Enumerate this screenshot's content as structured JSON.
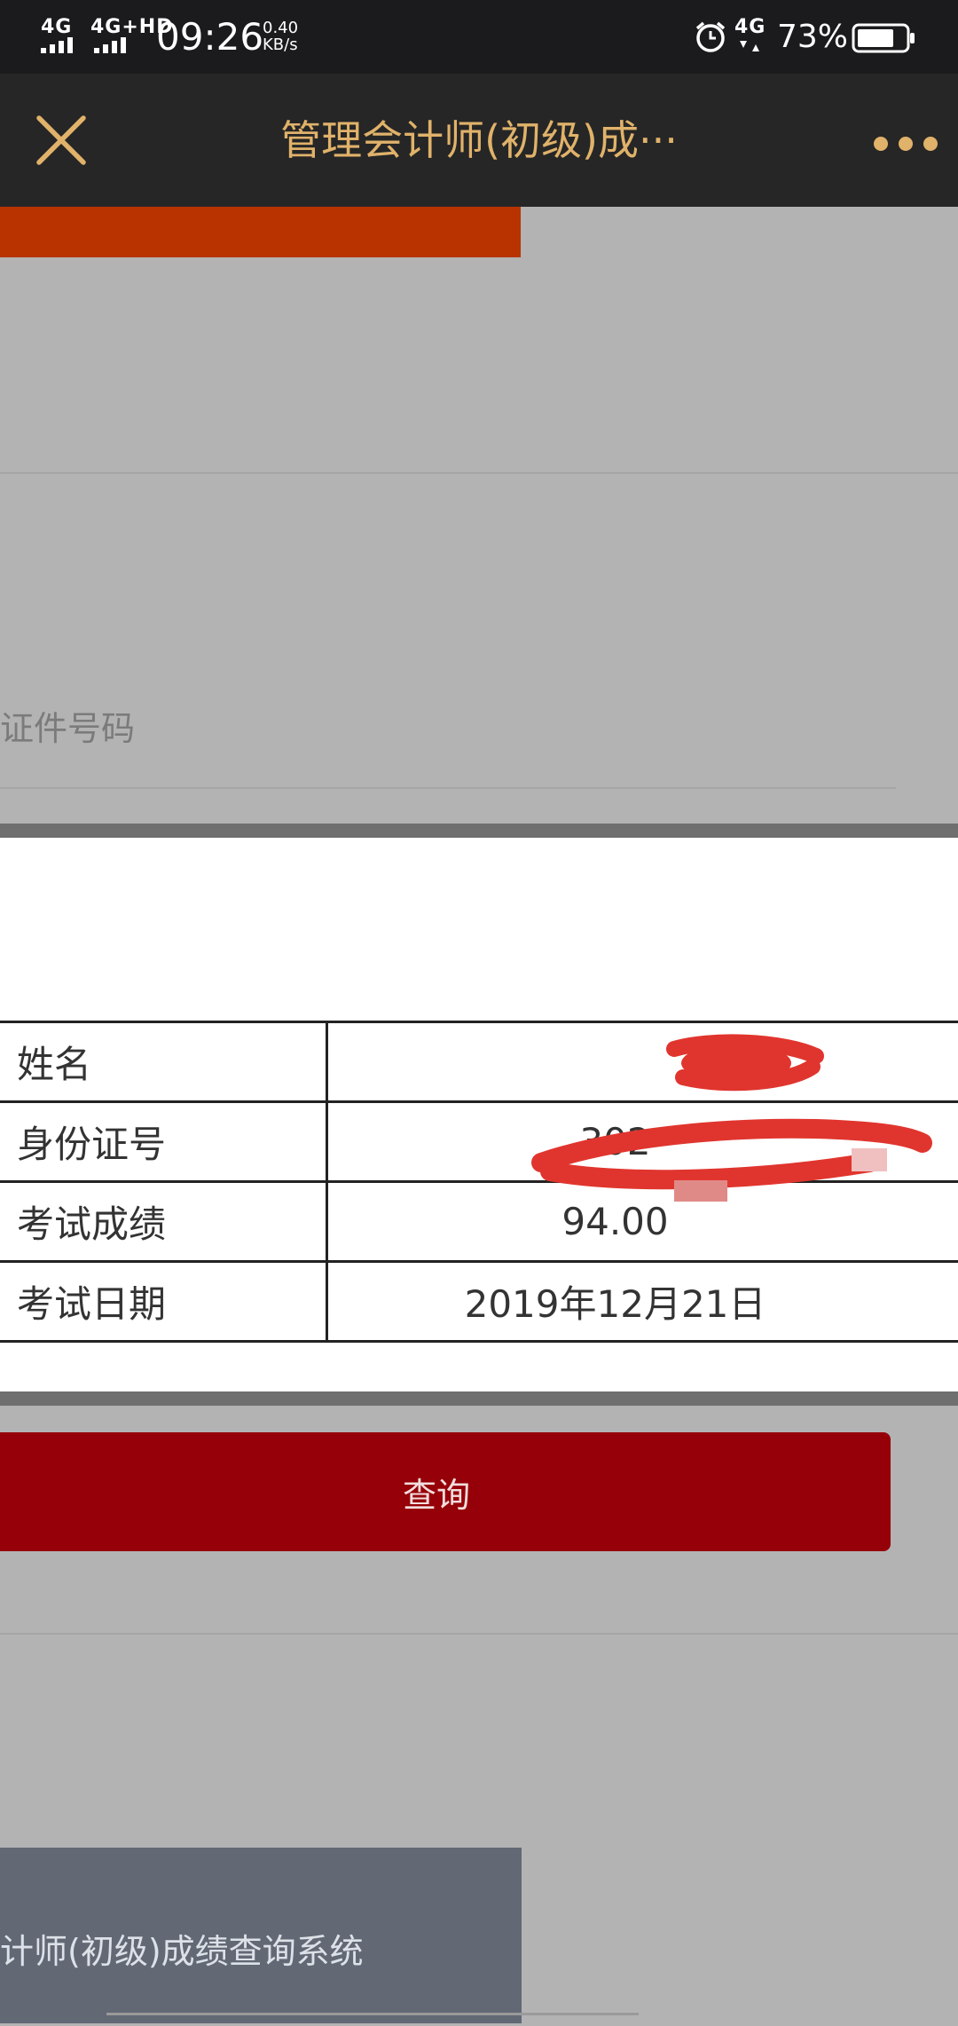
{
  "status_bar": {
    "signal1": "4G",
    "signal2": "4G+HD",
    "time": "09:26",
    "speed_value": "0.40",
    "speed_unit": "KB/s",
    "network": "4G",
    "battery": "73%"
  },
  "title_bar": {
    "title": "管理会计师(初级)成···"
  },
  "form": {
    "id_placeholder": "证件号码",
    "query_button": "查询"
  },
  "result": {
    "rows": [
      {
        "label": "姓名",
        "value": ""
      },
      {
        "label": "身份证号",
        "value": "302"
      },
      {
        "label": "考试成绩",
        "value": "94.00"
      },
      {
        "label": "考试日期",
        "value": "2019年12月21日"
      }
    ]
  },
  "footer": {
    "system_name": "计师(初级)成绩查询系统"
  },
  "colors": {
    "accent_gold": "#e0b26a",
    "button_red": "#960008",
    "banner_orange": "#b83300",
    "redaction_red": "#e0352e"
  }
}
